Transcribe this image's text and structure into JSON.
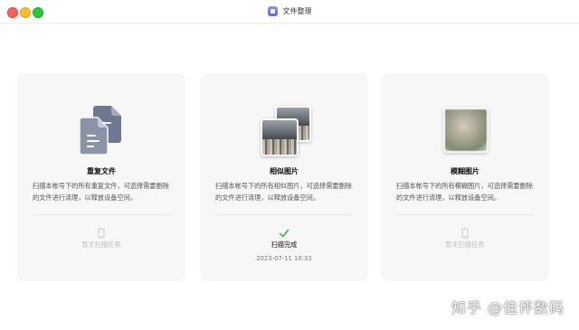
{
  "window": {
    "title": "文件整理"
  },
  "cards": [
    {
      "title": "重复文件",
      "description": "扫描本帐号下的所有重复文件，可选择需要删除的文件进行清理，以释放设备空间。",
      "status": "暂无扫描任务",
      "icon": "duplicate-files-icon"
    },
    {
      "title": "相似图片",
      "description": "扫描本帐号下的所有相似图片，可选择需要删除的文件进行清理，以释放设备空间。",
      "status": "扫描完成",
      "timestamp": "2023-07-11 10:33",
      "icon": "similar-photos-icon"
    },
    {
      "title": "模糊图片",
      "description": "扫描本帐号下的所有模糊图片，可选择需要删除的文件进行清理，以释放设备空间。",
      "status": "暂无扫描任务",
      "icon": "blurry-photo-icon"
    }
  ],
  "watermark": "知乎 @佳评数码",
  "colors": {
    "card_bg": "#f7f7f7",
    "success": "#2fb34a",
    "muted": "#bdbdbd",
    "doc_icon_dark": "#6e7890",
    "doc_icon_light": "#8a93a8"
  }
}
